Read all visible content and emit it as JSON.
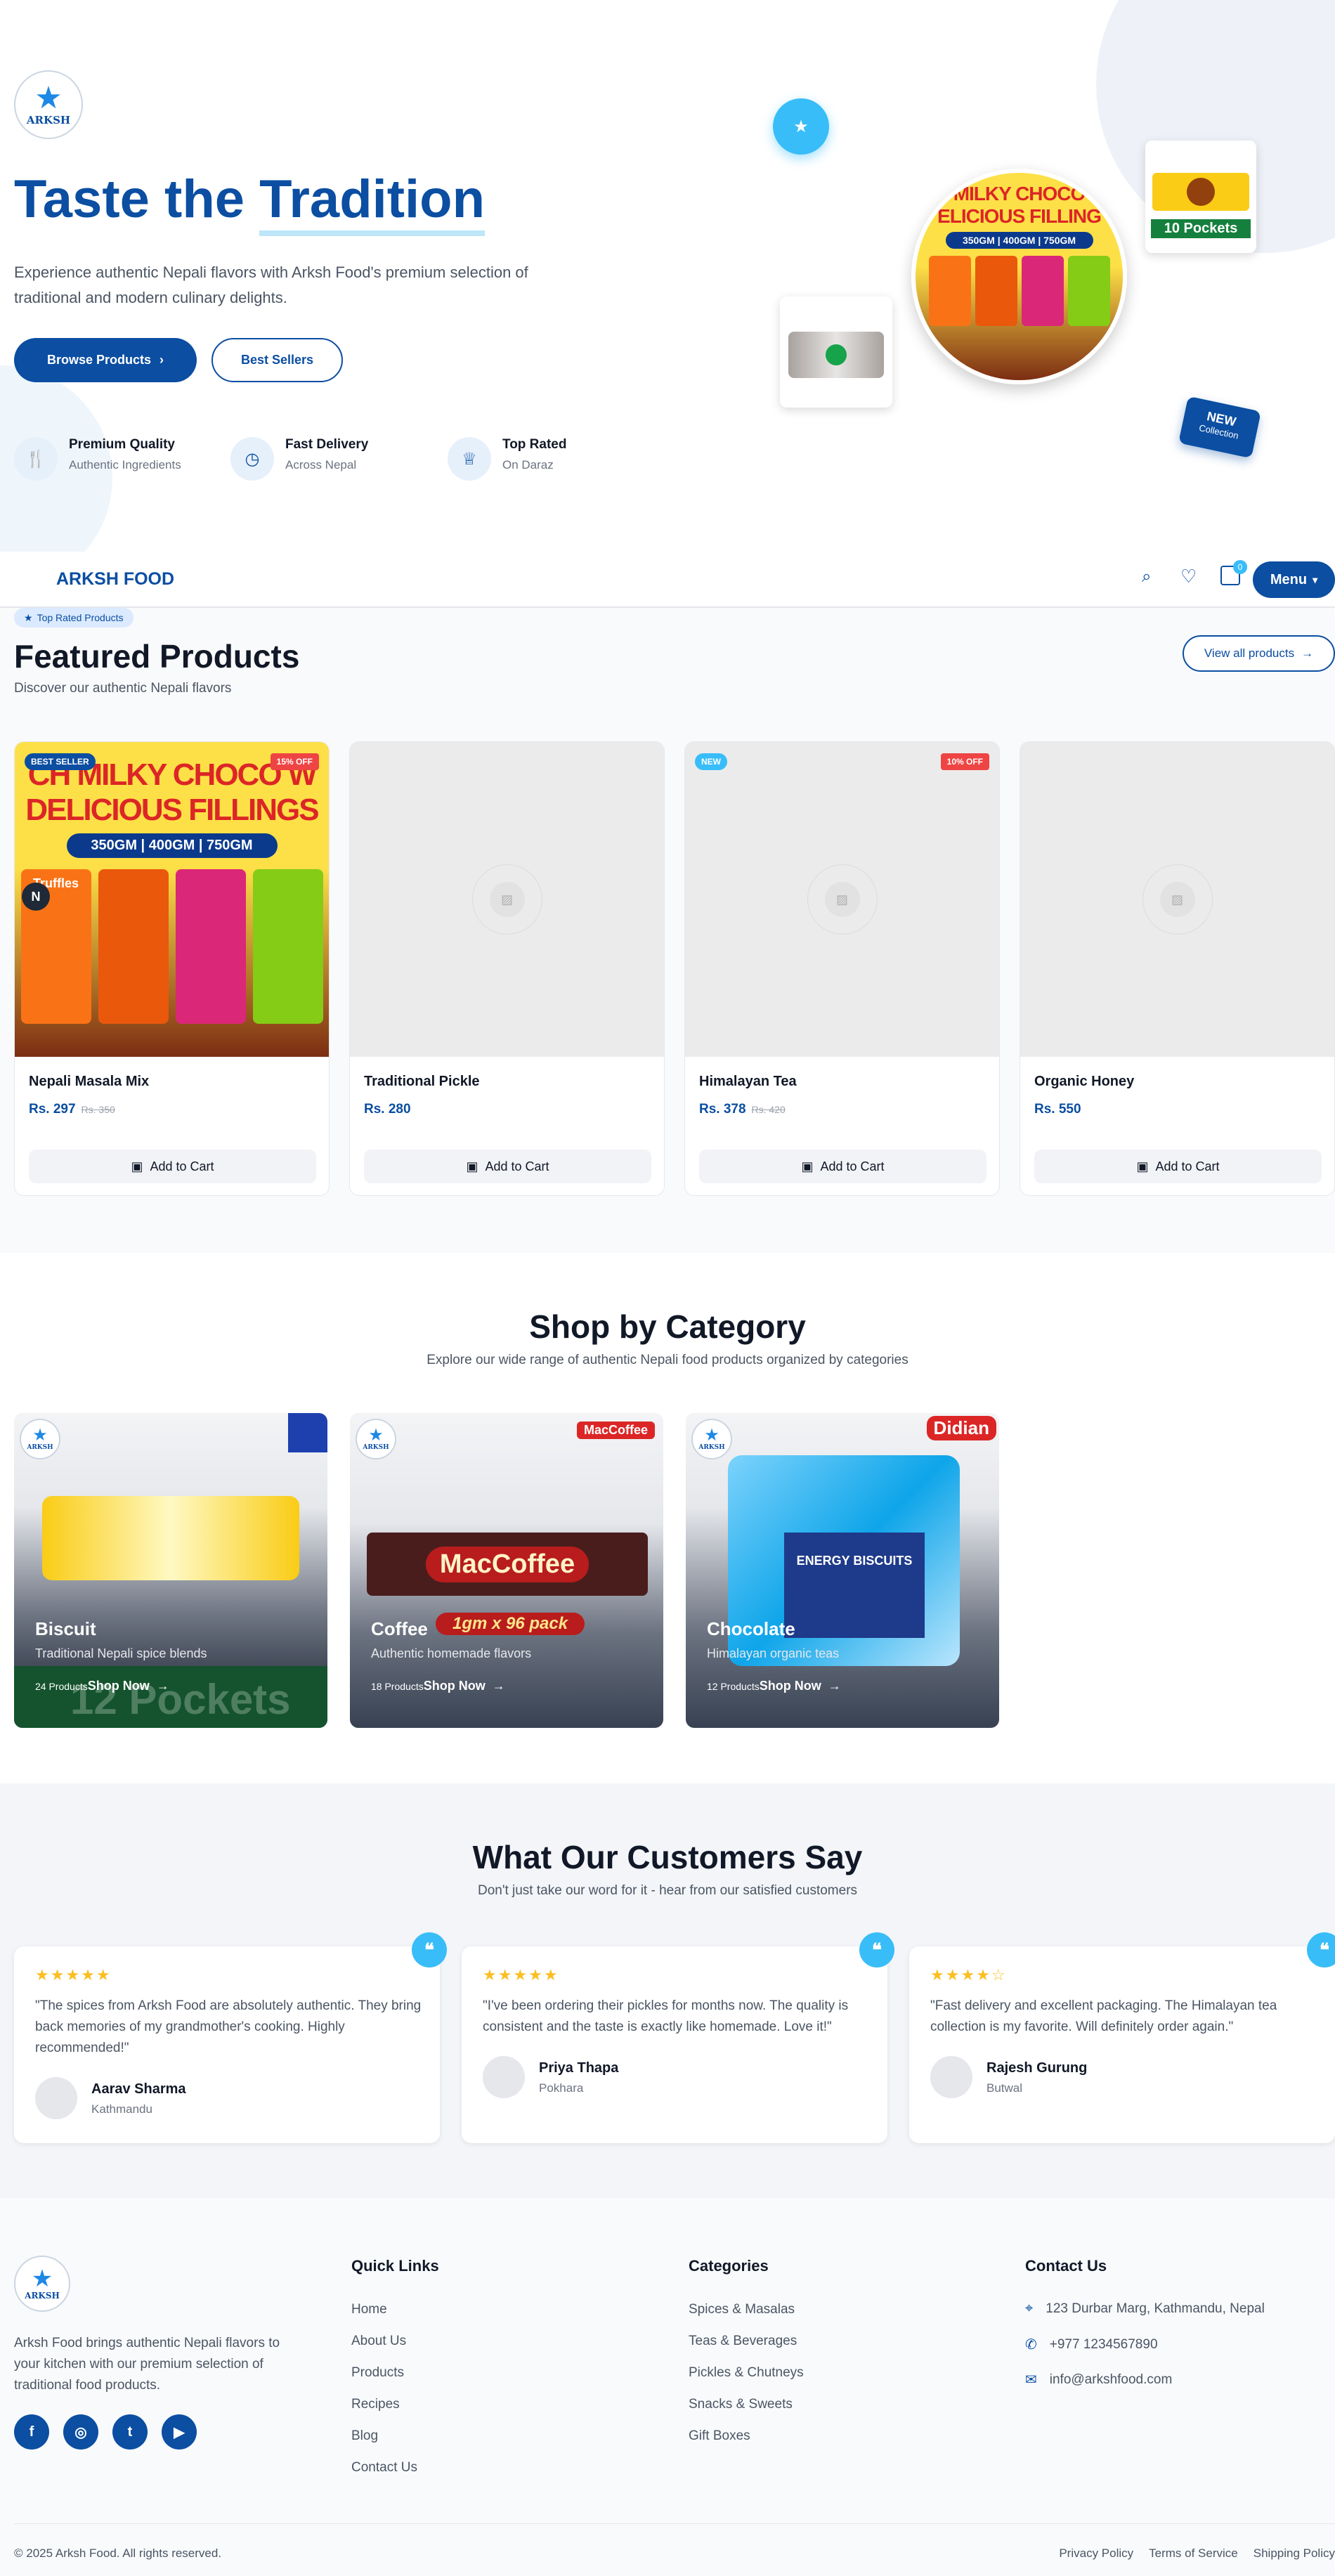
{
  "brand": {
    "logo_text": "ARKSH",
    "nav_name": "ARKSH FOOD"
  },
  "hero": {
    "title_part1": "Taste the ",
    "title_part2": "Tradition",
    "description": "Experience authentic Nepali flavors with Arksh Food's premium selection of traditional and modern culinary delights.",
    "btn_browse": "Browse Products",
    "btn_best": "Best Sellers",
    "features": [
      {
        "title": "Premium Quality",
        "sub": "Authentic Ingredients"
      },
      {
        "title": "Fast Delivery",
        "sub": "Across Nepal"
      },
      {
        "title": "Top Rated",
        "sub": "On Daraz"
      }
    ],
    "pack_label": "10 Pockets",
    "circle_line1": "MILKY CHOCO",
    "circle_line2": "ELICIOUS FILLING",
    "circle_weight": "350GM | 400GM | 750GM",
    "new_badge": "NEW",
    "new_badge_sub": "Collection"
  },
  "nav": {
    "cart_count": "0",
    "menu_label": "Menu"
  },
  "featured": {
    "tag": "Top Rated Products",
    "title": "Featured Products",
    "subtitle": "Discover our authentic Nepali flavors",
    "view_all": "View all products",
    "img_line1": "CH MILKY CHOCO W",
    "img_line2": "DELICIOUS FILLINGS",
    "img_weight": "350GM | 400GM | 750GM",
    "img_brand": "Truffles",
    "n_badge": "N",
    "products": [
      {
        "name": "Nepali Masala Mix",
        "price": "Rs. 297",
        "old": "Rs. 350",
        "badge_left": "BEST SELLER",
        "badge_right": "15% OFF",
        "cart": "Add to Cart"
      },
      {
        "name": "Traditional Pickle",
        "price": "Rs. 280",
        "old": "",
        "badge_left": "",
        "badge_right": "",
        "cart": "Add to Cart"
      },
      {
        "name": "Himalayan Tea",
        "price": "Rs. 378",
        "old": "Rs. 420",
        "badge_left": "NEW",
        "badge_right": "10% OFF",
        "cart": "Add to Cart"
      },
      {
        "name": "Organic Honey",
        "price": "Rs. 550",
        "old": "",
        "badge_left": "",
        "badge_right": "",
        "cart": "Add to Cart"
      }
    ]
  },
  "categories": {
    "title": "Shop by Category",
    "subtitle": "Explore our wide range of authentic Nepali food products organized by categories",
    "items": [
      {
        "name": "Biscuit",
        "desc": "Traditional Nepali spice blends",
        "count": "24 Products",
        "shop": "Shop Now",
        "brand": "",
        "pack_text": "12 Pockets"
      },
      {
        "name": "Coffee",
        "desc": "Authentic homemade flavors",
        "count": "18 Products",
        "shop": "Shop Now",
        "brand": "MacCoffee",
        "pack_text": "1gm x 96 pack"
      },
      {
        "name": "Chocolate",
        "desc": "Himalayan organic teas",
        "count": "12 Products",
        "shop": "Shop Now",
        "brand": "Didian",
        "pack_text": "ENERGY BISCUITS"
      }
    ]
  },
  "testimonials": {
    "title": "What Our Customers Say",
    "subtitle": "Don't just take our word for it - hear from our satisfied customers",
    "items": [
      {
        "stars": "★★★★★",
        "quote": "\"The spices from Arksh Food are absolutely authentic. They bring back memories of my grandmother's cooking. Highly recommended!\"",
        "name": "Aarav Sharma",
        "city": "Kathmandu"
      },
      {
        "stars": "★★★★★",
        "quote": "\"I've been ordering their pickles for months now. The quality is consistent and the taste is exactly like homemade. Love it!\"",
        "name": "Priya Thapa",
        "city": "Pokhara"
      },
      {
        "stars": "★★★★☆",
        "quote": "\"Fast delivery and excellent packaging. The Himalayan tea collection is my favorite. Will definitely order again.\"",
        "name": "Rajesh Gurung",
        "city": "Butwal"
      }
    ]
  },
  "footer": {
    "about": "Arksh Food brings authentic Nepali flavors to your kitchen with our premium selection of traditional food products.",
    "quick_title": "Quick Links",
    "quick_links": [
      "Home",
      "About Us",
      "Products",
      "Recipes",
      "Blog",
      "Contact Us"
    ],
    "cat_title": "Categories",
    "cat_links": [
      "Spices & Masalas",
      "Teas & Beverages",
      "Pickles & Chutneys",
      "Snacks & Sweets",
      "Gift Boxes"
    ],
    "contact_title": "Contact Us",
    "address": "123 Durbar Marg, Kathmandu, Nepal",
    "phone": "+977 1234567890",
    "email": "info@arkshfood.com",
    "copyright": "© 2025 Arksh Food. All rights reserved.",
    "legal": [
      "Privacy Policy",
      "Terms of Service",
      "Shipping Policy"
    ]
  }
}
